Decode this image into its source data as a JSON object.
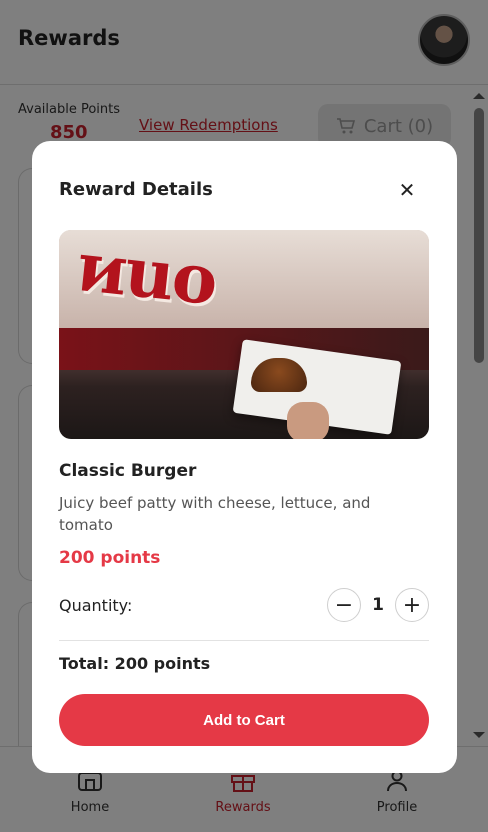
{
  "header": {
    "title": "Rewards"
  },
  "points": {
    "label": "Available Points",
    "value": "850"
  },
  "links": {
    "view_redemptions": "View Redemptions"
  },
  "cart": {
    "label": "Cart (0)"
  },
  "bottom_nav": {
    "items": [
      {
        "label": "Home",
        "icon": "home-icon"
      },
      {
        "label": "Rewards",
        "icon": "gift-icon",
        "active": true
      },
      {
        "label": "Profile",
        "icon": "user-icon"
      }
    ]
  },
  "modal": {
    "title": "Reward Details",
    "close_icon": "close-icon",
    "item": {
      "name": "Classic Burger",
      "description": "Juicy beef patty with cheese, lettuce, and tomato",
      "points": "200 points"
    },
    "quantity": {
      "label": "Quantity:",
      "value": "1",
      "minus": "−",
      "plus": "+"
    },
    "total": "Total: 200 points",
    "add_button": "Add to Cart"
  },
  "colors": {
    "accent": "#e53946",
    "brand_dark": "#c8202c"
  }
}
